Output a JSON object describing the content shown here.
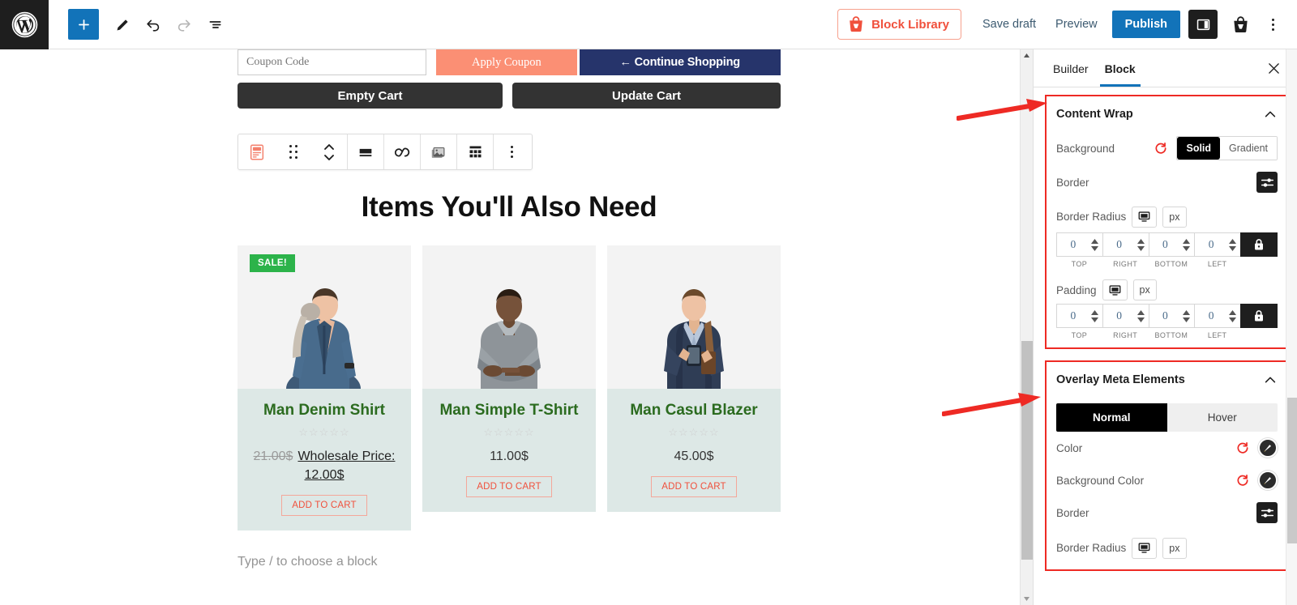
{
  "topbar": {
    "logo_icon": "wordpress-logo-icon",
    "add_block_icon": "plus-icon",
    "edit_icon": "pencil-icon",
    "undo_icon": "undo-arrow-icon",
    "redo_icon": "redo-arrow-icon",
    "list_view_icon": "list-view-icon",
    "block_library_label": "Block Library",
    "block_library_icon": "shopping-bag-icon",
    "save_draft_label": "Save draft",
    "preview_label": "Preview",
    "publish_label": "Publish",
    "sidebar_toggle_icon": "sidebar-panel-icon",
    "plugin_icon": "shopping-bag-icon",
    "options_icon": "kebab-menu-icon",
    "accent_blue": "#1273b9",
    "accent_orange": "#f0503c"
  },
  "canvas": {
    "cart": {
      "coupon_placeholder": "Coupon Code",
      "coupon_value": "",
      "apply_coupon_label": "Apply Coupon",
      "continue_shopping_label": "← Continue Shopping",
      "empty_cart_label": "Empty Cart",
      "update_cart_label": "Update Cart",
      "apply_coupon_color": "#fb8f74",
      "continue_shopping_color": "#26346b",
      "dark_button_color": "#333333"
    },
    "block_toolbar": {
      "block_type_icon": "product-block-icon",
      "drag_handle_icon": "drag-handle-icon",
      "move_updown_icon": "move-up-down-icon",
      "align_icon": "align-icon",
      "link_icon": "link-infinity-icon",
      "image_icon": "image-icon",
      "grid_icon": "grid-layout-icon",
      "more_icon": "more-options-icon"
    },
    "section_heading": "Items You'll Also Need",
    "products": [
      {
        "name": "Man Denim Shirt",
        "badge": "SALE!",
        "rating_stars": "☆☆☆☆☆",
        "old_price": "21.00$",
        "price_label": "Wholesale Price: 12.00$",
        "has_wholesale": true,
        "add_to_cart_label": "ADD TO CART",
        "image_alt": "man-denim-shirt-photo"
      },
      {
        "name": "Man Simple T-Shirt",
        "badge": "",
        "rating_stars": "☆☆☆☆☆",
        "old_price": "",
        "price_label": "11.00$",
        "has_wholesale": false,
        "add_to_cart_label": "ADD TO CART",
        "image_alt": "man-simple-tshirt-photo"
      },
      {
        "name": "Man Casul Blazer",
        "badge": "",
        "rating_stars": "☆☆☆☆☆",
        "old_price": "",
        "price_label": "45.00$",
        "has_wholesale": false,
        "add_to_cart_label": "ADD TO CART",
        "image_alt": "man-casual-blazer-photo"
      }
    ],
    "paragraph_placeholder": "Type / to choose a block",
    "card_body_color": "#dde8e6",
    "product_title_color": "#2b6b1f",
    "sale_badge_color": "#2cb34a"
  },
  "panel": {
    "tabs": [
      {
        "label": "Builder",
        "active": false
      },
      {
        "label": "Block",
        "active": true
      }
    ],
    "close_icon": "close-icon",
    "sections": [
      {
        "title": "Content Wrap",
        "collapse_icon": "chevron-up-icon",
        "rows": {
          "background_label": "Background",
          "background_reset_icon": "reset-icon",
          "background_options": [
            "Solid",
            "Gradient"
          ],
          "background_selected": "Solid",
          "border_label": "Border",
          "border_settings_icon": "sliders-icon",
          "border_radius_label": "Border Radius",
          "border_radius_device_icon": "desktop-icon",
          "border_radius_unit": "px",
          "border_radius_values": [
            "0",
            "0",
            "0",
            "0"
          ],
          "border_radius_lock_icon": "lock-icon",
          "padding_label": "Padding",
          "padding_device_icon": "desktop-icon",
          "padding_unit": "px",
          "padding_values": [
            "0",
            "0",
            "0",
            "0"
          ],
          "padding_lock_icon": "lock-icon",
          "side_labels": [
            "TOP",
            "RIGHT",
            "BOTTOM",
            "LEFT"
          ]
        }
      },
      {
        "title": "Overlay Meta Elements",
        "collapse_icon": "chevron-up-icon",
        "rows": {
          "state_options": [
            "Normal",
            "Hover"
          ],
          "state_selected": "Normal",
          "color_label": "Color",
          "color_reset_icon": "reset-icon",
          "color_picker_icon": "color-picker-icon",
          "background_color_label": "Background Color",
          "background_color_reset_icon": "reset-icon",
          "background_color_picker_icon": "color-picker-icon",
          "border_label": "Border",
          "border_settings_icon": "sliders-icon",
          "border_radius_label": "Border Radius",
          "border_radius_device_icon": "desktop-icon",
          "border_radius_unit": "px"
        }
      }
    ],
    "highlight_color": "#ee2a24"
  },
  "annotations": {
    "arrow_color": "#ee2a24",
    "arrow_1_target": "content-wrap-section",
    "arrow_2_target": "overlay-meta-elements-section"
  }
}
